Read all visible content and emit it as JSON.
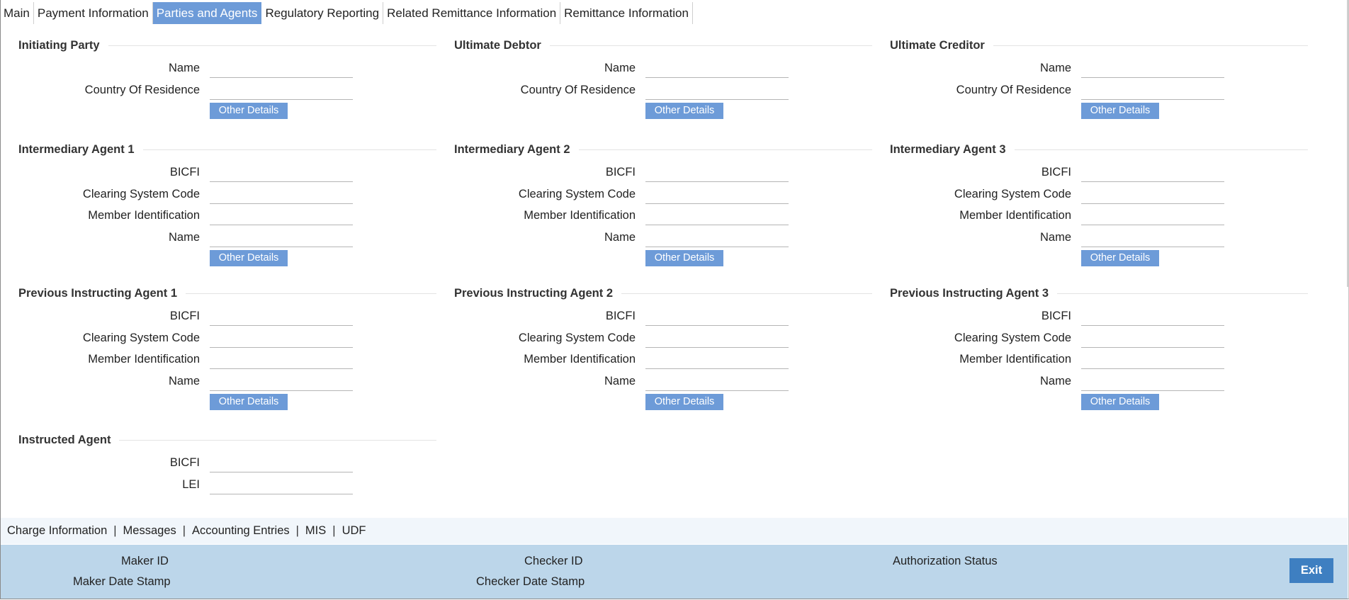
{
  "tabs": [
    "Main",
    "Payment Information",
    "Parties and Agents",
    "Regulatory Reporting",
    "Related Remittance Information",
    "Remittance Information"
  ],
  "active_tab": "Parties and Agents",
  "labels": {
    "name": "Name",
    "country_of_residence": "Country Of Residence",
    "bicfi": "BICFI",
    "clearing_system_code": "Clearing System Code",
    "member_identification": "Member Identification",
    "lei": "LEI",
    "other_details": "Other Details"
  },
  "sections": {
    "initiating_party": {
      "title": "Initiating Party"
    },
    "ultimate_debtor": {
      "title": "Ultimate Debtor"
    },
    "ultimate_creditor": {
      "title": "Ultimate Creditor"
    },
    "intermediary_agent_1": {
      "title": "Intermediary Agent 1"
    },
    "intermediary_agent_2": {
      "title": "Intermediary Agent 2"
    },
    "intermediary_agent_3": {
      "title": "Intermediary Agent 3"
    },
    "previous_instructing_agent_1": {
      "title": "Previous Instructing Agent 1"
    },
    "previous_instructing_agent_2": {
      "title": "Previous Instructing Agent 2"
    },
    "previous_instructing_agent_3": {
      "title": "Previous Instructing Agent 3"
    },
    "instructed_agent": {
      "title": "Instructed Agent"
    }
  },
  "footer_links": [
    "Charge Information",
    "Messages",
    "Accounting Entries",
    "MIS",
    "UDF"
  ],
  "footer_separator": "|",
  "status": {
    "maker_id": "Maker ID",
    "maker_date_stamp": "Maker Date Stamp",
    "checker_id": "Checker ID",
    "checker_date_stamp": "Checker Date Stamp",
    "authorization_status": "Authorization Status",
    "exit": "Exit"
  },
  "colors": {
    "active_tab": "#6d9bd8",
    "button": "#6d9bd8",
    "status_bar": "#bcd6ea",
    "link_bar": "#f1f6fb",
    "exit_button": "#3e7fc1"
  }
}
